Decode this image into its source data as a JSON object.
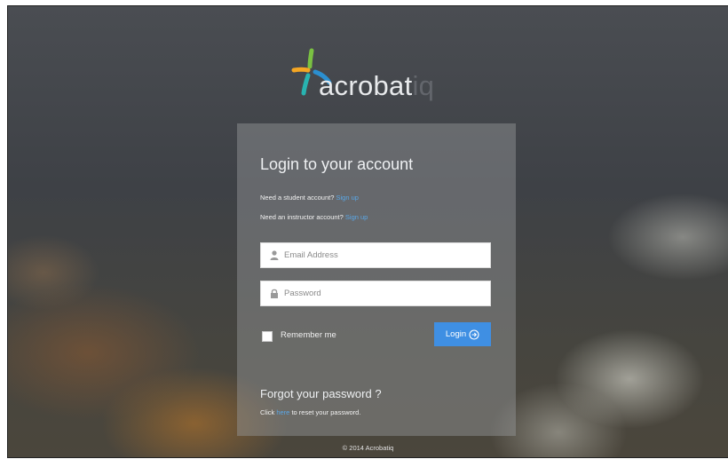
{
  "brand": {
    "logo_text": "acrobat",
    "logo_text_suffix": "iq",
    "colors": {
      "blue": "#2b8fd0",
      "green": "#7ac142",
      "orange": "#f5a623",
      "teal": "#28b3b0"
    }
  },
  "login": {
    "title": "Login to your account",
    "student_prompt": "Need a student account?",
    "student_link": "Sign up",
    "instructor_prompt": "Need an instructor account?",
    "instructor_link": "Sign up",
    "email_placeholder": "Email Address",
    "password_placeholder": "Password",
    "remember_label": "Remember me",
    "login_button": "Login",
    "forgot_title": "Forgot your password ?",
    "reset_prefix": "Click",
    "reset_link": "here",
    "reset_suffix": "to reset your password."
  },
  "footer": {
    "copyright": "© 2014 Acrobatiq"
  },
  "icons": {
    "email_field": "user-icon",
    "password_field": "lock-icon",
    "login_button": "arrow-circle-right-icon"
  },
  "theme": {
    "accent": "#3f8fe3",
    "link": "#5aa7e6"
  }
}
